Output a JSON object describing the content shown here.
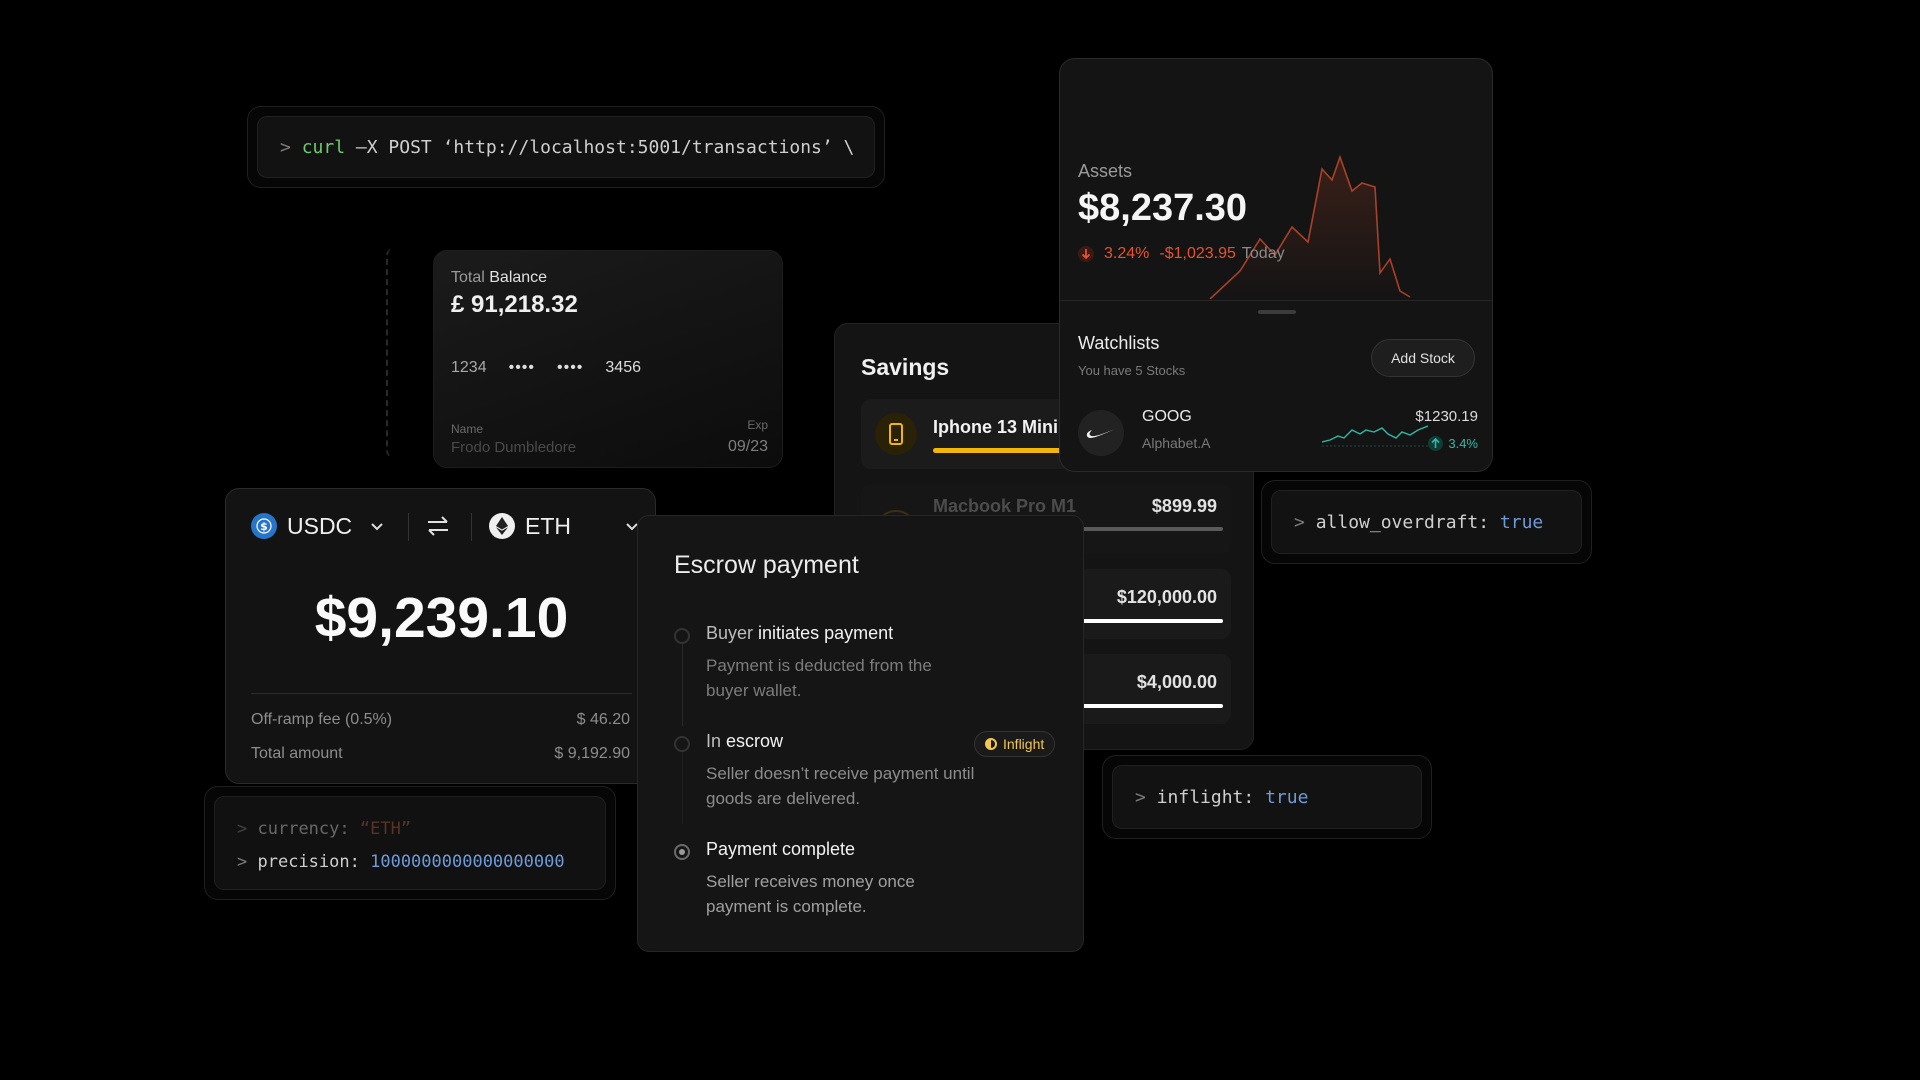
{
  "curl": {
    "prompt": ">",
    "cmd": "curl",
    "args": "–X POST ‘http://localhost:5001/transactions’ \\"
  },
  "balance_card": {
    "label_prefix": "Total",
    "label_bold": "Balance",
    "amount": "£ 91,218.32",
    "card_first": "1234",
    "card_mask_1": "••••",
    "card_mask_2": "••••",
    "card_last": "3456",
    "name_label": "Name",
    "name_value": "Frodo Dumbledore",
    "exp_label": "Exp",
    "exp_value": "09/23"
  },
  "savings": {
    "title": "Savings",
    "items": [
      {
        "name": "Iphone 13 Mini",
        "amount": "",
        "progress": 0.9,
        "color": "#f2b705"
      },
      {
        "name": "Macbook Pro M1",
        "amount": "$899.99",
        "progress": 0.35,
        "color": "#e0a030"
      },
      {
        "name": "",
        "amount": "$120,000.00",
        "progress": 1.0,
        "color": "#ffffff"
      },
      {
        "name": "",
        "amount": "$4,000.00",
        "progress": 1.0,
        "color": "#ffffff"
      }
    ]
  },
  "assets": {
    "label": "Assets",
    "amount": "$8,237.30",
    "pct": "3.24%",
    "delta": "-$1,023.95",
    "period": "Today",
    "trend_color": "#e5532f"
  },
  "watchlist": {
    "title": "Watchlists",
    "subtitle": "You have 5 Stocks",
    "add_button": "Add Stock",
    "stock": {
      "ticker": "GOOG",
      "company": "Alphabet.A",
      "price": "$1230.19",
      "change": "3.4%"
    }
  },
  "swap": {
    "from_token": "USDC",
    "to_token": "ETH",
    "amount": "$9,239.10",
    "fee_label": "Off-ramp fee (0.5%)",
    "fee_value": "$ 46.20",
    "total_label": "Total amount",
    "total_value": "$ 9,192.90"
  },
  "escrow": {
    "title": "Escrow payment",
    "steps": [
      {
        "title_pre": "Buyer",
        "title_bold": "initiates payment",
        "desc": "Payment is deducted from the buyer wallet."
      },
      {
        "title_pre": "In",
        "title_bold": "escrow",
        "desc": "Seller doesn’t receive payment until goods are delivered.",
        "badge": "Inflight"
      },
      {
        "title_pre": "",
        "title_bold": "Payment complete",
        "desc": "Seller receives money once payment is complete."
      }
    ]
  },
  "code_currency": {
    "line1_key": "currency:",
    "line1_val": "“ETH”",
    "line2_key": "precision:",
    "line2_val": "1000000000000000000"
  },
  "code_overdraft": {
    "key": "allow_overdraft:",
    "val": "true"
  },
  "code_inflight": {
    "key": "inflight:",
    "val": "true"
  }
}
